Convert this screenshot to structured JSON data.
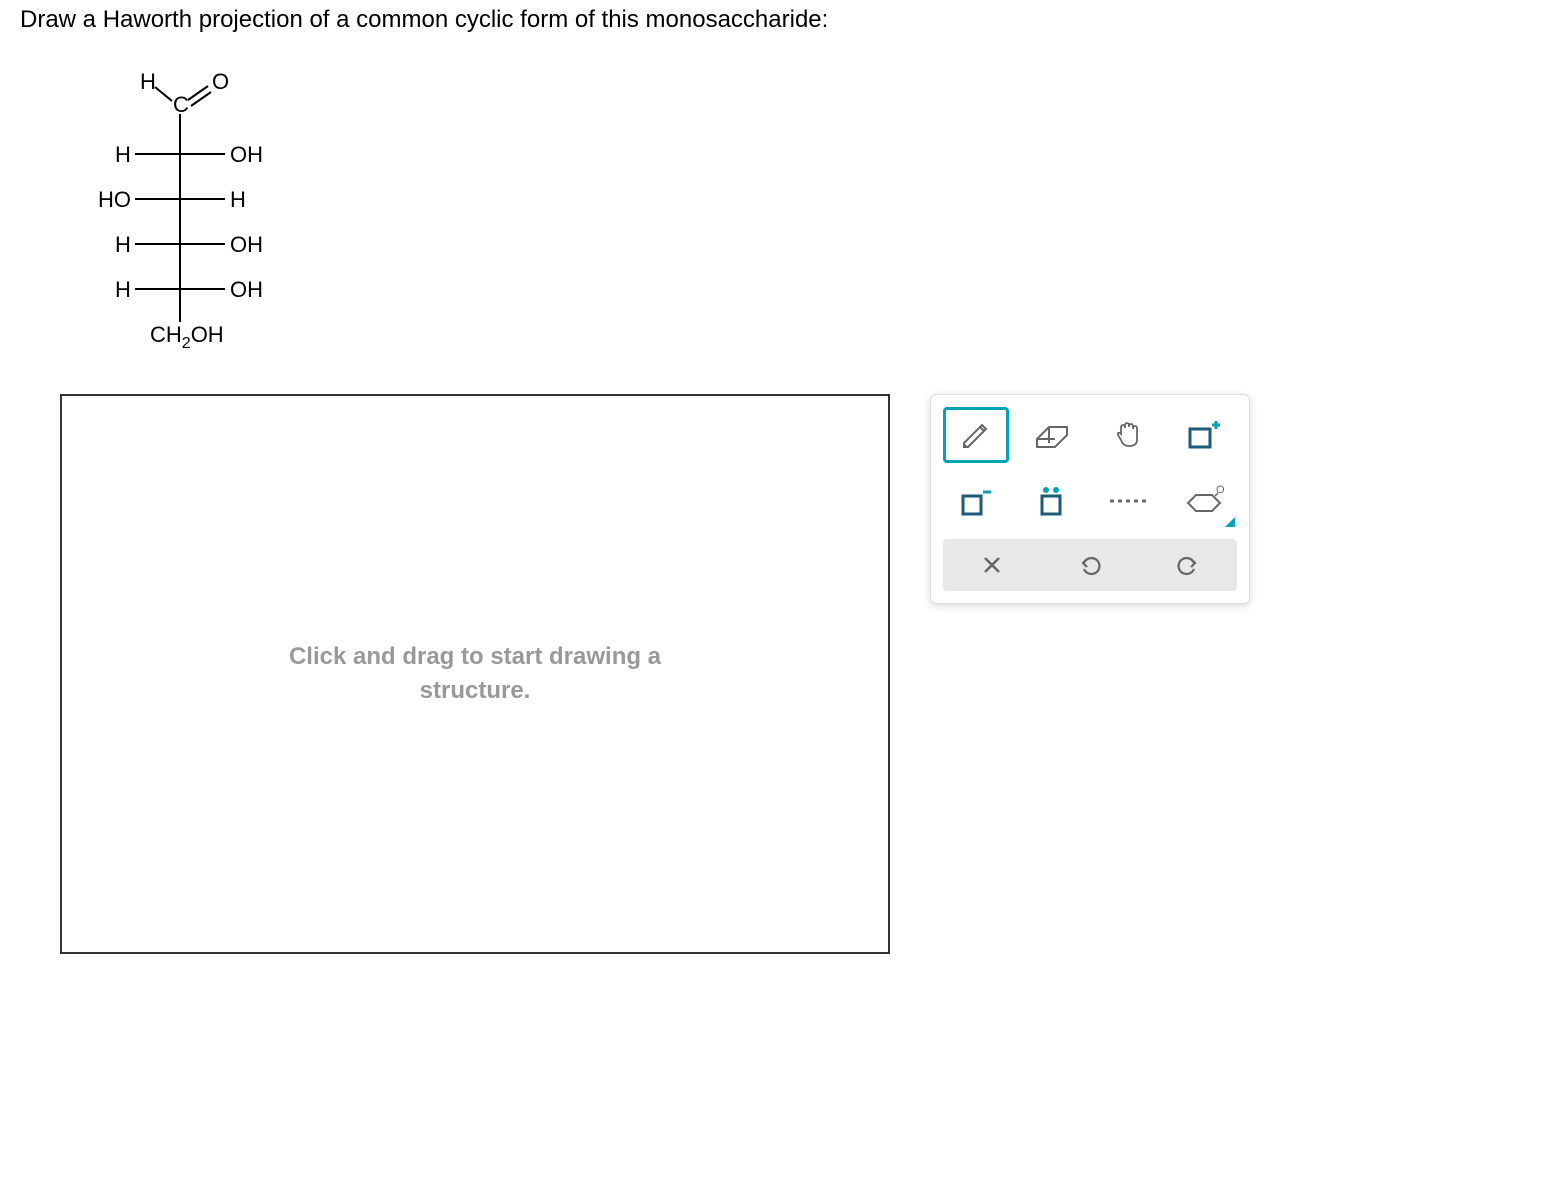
{
  "question": "Draw a Haworth projection of a common cyclic form of this monosaccharide:",
  "fischer": {
    "c1_left": "H",
    "c1_top": "C",
    "c1_right": "O",
    "c2_left": "H",
    "c2_right": "OH",
    "c3_left": "HO",
    "c3_right": "H",
    "c4_left": "H",
    "c4_right": "OH",
    "c5_left": "H",
    "c5_right": "OH",
    "c6": "CH",
    "c6_sub": "2",
    "c6_end": "OH"
  },
  "canvas": {
    "hint_line1": "Click and drag to start drawing a",
    "hint_line2": "structure."
  },
  "tools": {
    "pencil": "pencil-icon",
    "eraser": "eraser-icon",
    "hand": "hand-icon",
    "select": "select-icon",
    "negcharge": "negative-charge-icon",
    "lonepair": "lone-pair-icon",
    "dashed": "dashed-bond-icon",
    "template": "ring-template-icon",
    "clear": "clear-icon",
    "undo": "undo-icon",
    "redo": "redo-icon"
  }
}
